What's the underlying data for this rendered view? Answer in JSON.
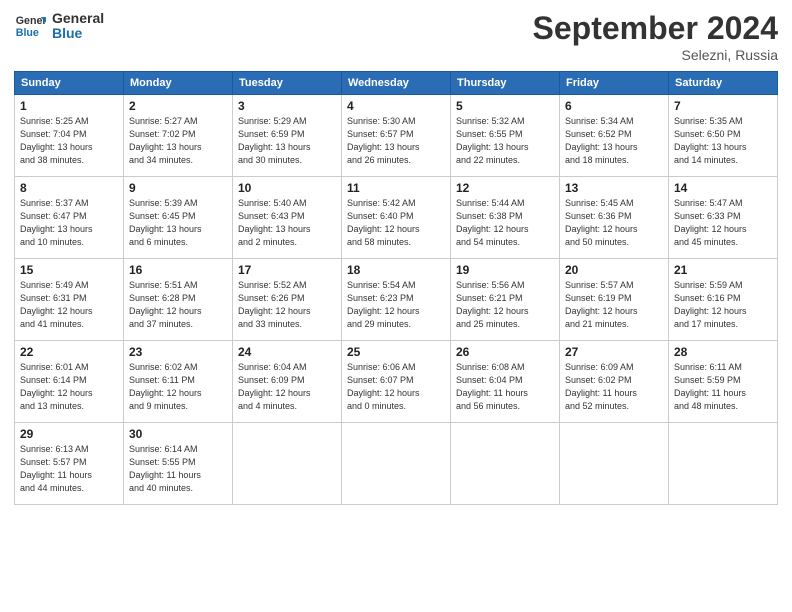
{
  "logo": {
    "line1": "General",
    "line2": "Blue"
  },
  "title": "September 2024",
  "subtitle": "Selezni, Russia",
  "headers": [
    "Sunday",
    "Monday",
    "Tuesday",
    "Wednesday",
    "Thursday",
    "Friday",
    "Saturday"
  ],
  "weeks": [
    [
      {
        "day": "1",
        "info": "Sunrise: 5:25 AM\nSunset: 7:04 PM\nDaylight: 13 hours\nand 38 minutes."
      },
      {
        "day": "2",
        "info": "Sunrise: 5:27 AM\nSunset: 7:02 PM\nDaylight: 13 hours\nand 34 minutes."
      },
      {
        "day": "3",
        "info": "Sunrise: 5:29 AM\nSunset: 6:59 PM\nDaylight: 13 hours\nand 30 minutes."
      },
      {
        "day": "4",
        "info": "Sunrise: 5:30 AM\nSunset: 6:57 PM\nDaylight: 13 hours\nand 26 minutes."
      },
      {
        "day": "5",
        "info": "Sunrise: 5:32 AM\nSunset: 6:55 PM\nDaylight: 13 hours\nand 22 minutes."
      },
      {
        "day": "6",
        "info": "Sunrise: 5:34 AM\nSunset: 6:52 PM\nDaylight: 13 hours\nand 18 minutes."
      },
      {
        "day": "7",
        "info": "Sunrise: 5:35 AM\nSunset: 6:50 PM\nDaylight: 13 hours\nand 14 minutes."
      }
    ],
    [
      {
        "day": "8",
        "info": "Sunrise: 5:37 AM\nSunset: 6:47 PM\nDaylight: 13 hours\nand 10 minutes."
      },
      {
        "day": "9",
        "info": "Sunrise: 5:39 AM\nSunset: 6:45 PM\nDaylight: 13 hours\nand 6 minutes."
      },
      {
        "day": "10",
        "info": "Sunrise: 5:40 AM\nSunset: 6:43 PM\nDaylight: 13 hours\nand 2 minutes."
      },
      {
        "day": "11",
        "info": "Sunrise: 5:42 AM\nSunset: 6:40 PM\nDaylight: 12 hours\nand 58 minutes."
      },
      {
        "day": "12",
        "info": "Sunrise: 5:44 AM\nSunset: 6:38 PM\nDaylight: 12 hours\nand 54 minutes."
      },
      {
        "day": "13",
        "info": "Sunrise: 5:45 AM\nSunset: 6:36 PM\nDaylight: 12 hours\nand 50 minutes."
      },
      {
        "day": "14",
        "info": "Sunrise: 5:47 AM\nSunset: 6:33 PM\nDaylight: 12 hours\nand 45 minutes."
      }
    ],
    [
      {
        "day": "15",
        "info": "Sunrise: 5:49 AM\nSunset: 6:31 PM\nDaylight: 12 hours\nand 41 minutes."
      },
      {
        "day": "16",
        "info": "Sunrise: 5:51 AM\nSunset: 6:28 PM\nDaylight: 12 hours\nand 37 minutes."
      },
      {
        "day": "17",
        "info": "Sunrise: 5:52 AM\nSunset: 6:26 PM\nDaylight: 12 hours\nand 33 minutes."
      },
      {
        "day": "18",
        "info": "Sunrise: 5:54 AM\nSunset: 6:23 PM\nDaylight: 12 hours\nand 29 minutes."
      },
      {
        "day": "19",
        "info": "Sunrise: 5:56 AM\nSunset: 6:21 PM\nDaylight: 12 hours\nand 25 minutes."
      },
      {
        "day": "20",
        "info": "Sunrise: 5:57 AM\nSunset: 6:19 PM\nDaylight: 12 hours\nand 21 minutes."
      },
      {
        "day": "21",
        "info": "Sunrise: 5:59 AM\nSunset: 6:16 PM\nDaylight: 12 hours\nand 17 minutes."
      }
    ],
    [
      {
        "day": "22",
        "info": "Sunrise: 6:01 AM\nSunset: 6:14 PM\nDaylight: 12 hours\nand 13 minutes."
      },
      {
        "day": "23",
        "info": "Sunrise: 6:02 AM\nSunset: 6:11 PM\nDaylight: 12 hours\nand 9 minutes."
      },
      {
        "day": "24",
        "info": "Sunrise: 6:04 AM\nSunset: 6:09 PM\nDaylight: 12 hours\nand 4 minutes."
      },
      {
        "day": "25",
        "info": "Sunrise: 6:06 AM\nSunset: 6:07 PM\nDaylight: 12 hours\nand 0 minutes."
      },
      {
        "day": "26",
        "info": "Sunrise: 6:08 AM\nSunset: 6:04 PM\nDaylight: 11 hours\nand 56 minutes."
      },
      {
        "day": "27",
        "info": "Sunrise: 6:09 AM\nSunset: 6:02 PM\nDaylight: 11 hours\nand 52 minutes."
      },
      {
        "day": "28",
        "info": "Sunrise: 6:11 AM\nSunset: 5:59 PM\nDaylight: 11 hours\nand 48 minutes."
      }
    ],
    [
      {
        "day": "29",
        "info": "Sunrise: 6:13 AM\nSunset: 5:57 PM\nDaylight: 11 hours\nand 44 minutes."
      },
      {
        "day": "30",
        "info": "Sunrise: 6:14 AM\nSunset: 5:55 PM\nDaylight: 11 hours\nand 40 minutes."
      },
      {
        "day": "",
        "info": ""
      },
      {
        "day": "",
        "info": ""
      },
      {
        "day": "",
        "info": ""
      },
      {
        "day": "",
        "info": ""
      },
      {
        "day": "",
        "info": ""
      }
    ]
  ]
}
